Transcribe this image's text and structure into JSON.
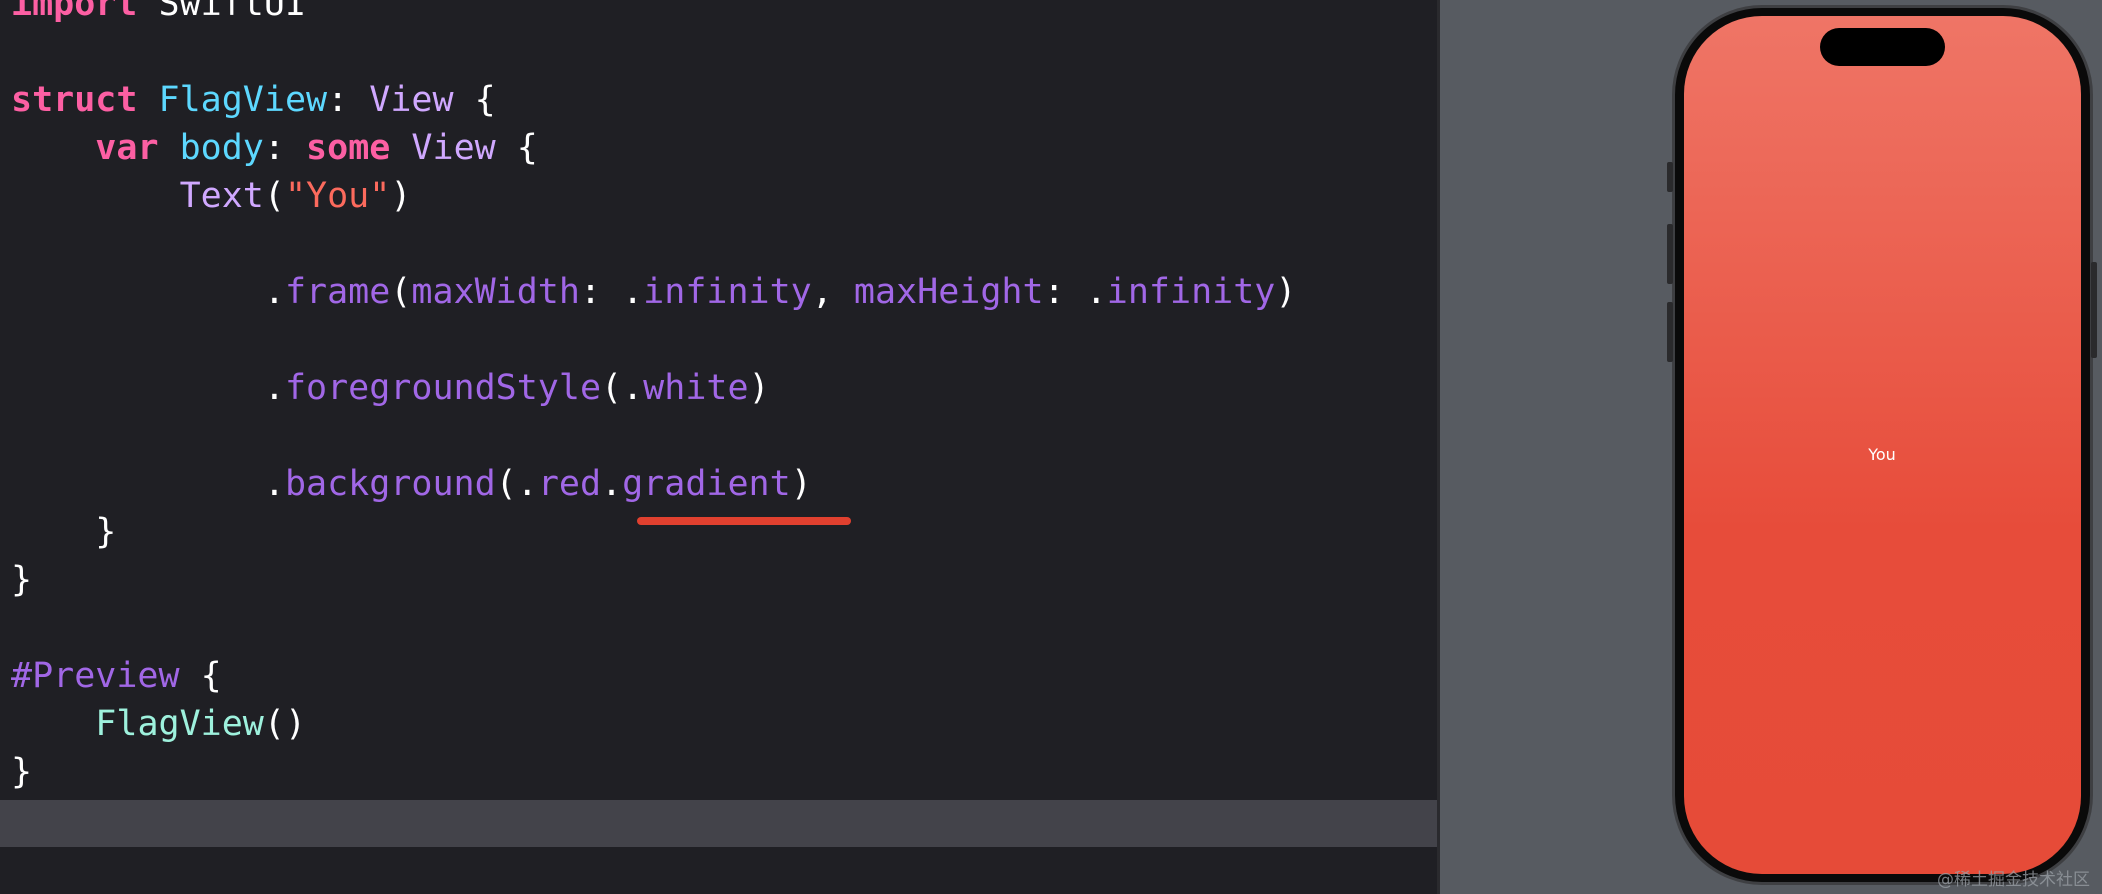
{
  "editor": {
    "lines": [
      [
        {
          "t": "import",
          "c": "kw"
        },
        {
          "t": " SwiftUI",
          "c": "pl"
        }
      ],
      [],
      [
        {
          "t": "struct",
          "c": "kw"
        },
        {
          "t": " ",
          "c": "pl"
        },
        {
          "t": "FlagView",
          "c": "cl"
        },
        {
          "t": ": ",
          "c": "pl"
        },
        {
          "t": "View",
          "c": "ty"
        },
        {
          "t": " {",
          "c": "pl"
        }
      ],
      [
        {
          "t": "    ",
          "c": "pl"
        },
        {
          "t": "var",
          "c": "kw"
        },
        {
          "t": " ",
          "c": "pl"
        },
        {
          "t": "body",
          "c": "cl"
        },
        {
          "t": ": ",
          "c": "pl"
        },
        {
          "t": "some",
          "c": "kw"
        },
        {
          "t": " ",
          "c": "pl"
        },
        {
          "t": "View",
          "c": "ty"
        },
        {
          "t": " {",
          "c": "pl"
        }
      ],
      [
        {
          "t": "        ",
          "c": "pl"
        },
        {
          "t": "Text",
          "c": "ty"
        },
        {
          "t": "(",
          "c": "pl"
        },
        {
          "t": "\"You\"",
          "c": "st"
        },
        {
          "t": ")",
          "c": "pl"
        }
      ],
      [],
      [
        {
          "t": "            .",
          "c": "pl"
        },
        {
          "t": "frame",
          "c": "mb"
        },
        {
          "t": "(",
          "c": "pl"
        },
        {
          "t": "maxWidth",
          "c": "mb"
        },
        {
          "t": ": .",
          "c": "pl"
        },
        {
          "t": "infinity",
          "c": "mb"
        },
        {
          "t": ", ",
          "c": "pl"
        },
        {
          "t": "maxHeight",
          "c": "mb"
        },
        {
          "t": ": .",
          "c": "pl"
        },
        {
          "t": "infinity",
          "c": "mb"
        },
        {
          "t": ")",
          "c": "pl"
        }
      ],
      [],
      [
        {
          "t": "            .",
          "c": "pl"
        },
        {
          "t": "foregroundStyle",
          "c": "mb"
        },
        {
          "t": "(.",
          "c": "pl"
        },
        {
          "t": "white",
          "c": "mb"
        },
        {
          "t": ")",
          "c": "pl"
        }
      ],
      [],
      [
        {
          "t": "            .",
          "c": "pl"
        },
        {
          "t": "background",
          "c": "mb"
        },
        {
          "t": "(.",
          "c": "pl"
        },
        {
          "t": "red",
          "c": "mb"
        },
        {
          "t": ".",
          "c": "pl"
        },
        {
          "t": "gradient",
          "c": "mb"
        },
        {
          "t": ")",
          "c": "pl"
        }
      ],
      [
        {
          "t": "    }",
          "c": "pl"
        }
      ],
      [
        {
          "t": "}",
          "c": "pl"
        }
      ],
      [],
      [
        {
          "t": "#Preview",
          "c": "pv"
        },
        {
          "t": " {",
          "c": "pl"
        }
      ],
      [
        {
          "t": "    ",
          "c": "pl"
        },
        {
          "t": "FlagView",
          "c": "fn"
        },
        {
          "t": "()",
          "c": "pl"
        }
      ],
      [
        {
          "t": "}",
          "c": "pl"
        }
      ]
    ]
  },
  "preview": {
    "text": "You"
  },
  "watermark": "@稀土掘金技术社区",
  "colors": {
    "keyword": "#fc5fa3",
    "type": "#d0a8ff",
    "class": "#5dd8ff",
    "string": "#fc6a5d",
    "member": "#a167e6",
    "underline": "#e0402f",
    "screen": "#e74c3a"
  }
}
